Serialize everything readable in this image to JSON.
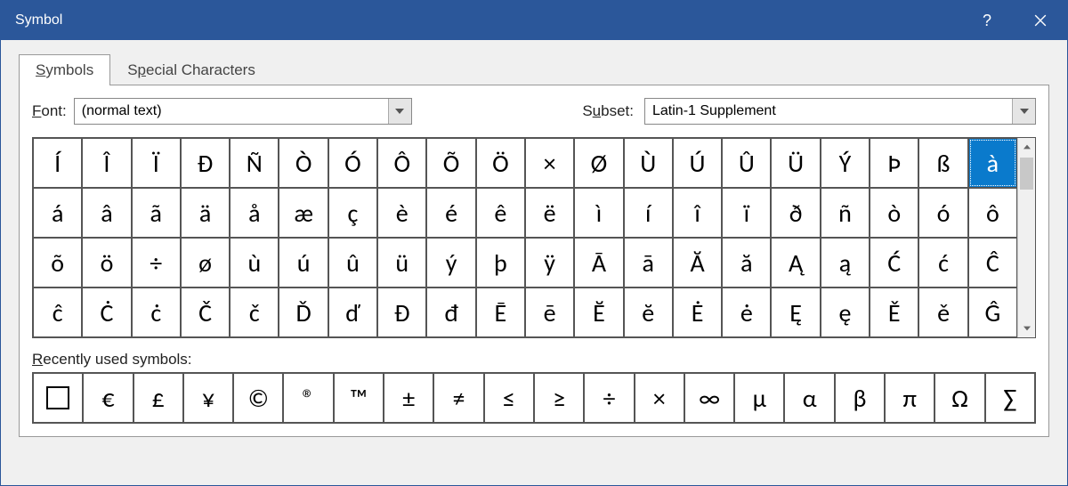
{
  "title": "Symbol",
  "tabs": {
    "symbols_prefix": "S",
    "symbols_rest": "ymbols",
    "special_prefix": "S",
    "special_mid": "p",
    "special_rest": "ecial Characters"
  },
  "font": {
    "label_prefix": "F",
    "label_rest": "ont:",
    "value": "(normal text)"
  },
  "subset": {
    "label_prefix": "S",
    "label_mid": "u",
    "label_rest": "bset:",
    "value": "Latin-1 Supplement"
  },
  "selected_index": 19,
  "grid": [
    "Í",
    "Î",
    "Ï",
    "Đ",
    "Ñ",
    "Ò",
    "Ó",
    "Ô",
    "Õ",
    "Ö",
    "×",
    "Ø",
    "Ù",
    "Ú",
    "Û",
    "Ü",
    "Ý",
    "Þ",
    "ß",
    "à",
    "á",
    "â",
    "ã",
    "ä",
    "å",
    "æ",
    "ç",
    "è",
    "é",
    "ê",
    "ë",
    "ì",
    "í",
    "î",
    "ï",
    "ð",
    "ñ",
    "ò",
    "ó",
    "ô",
    "õ",
    "ö",
    "÷",
    "ø",
    "ù",
    "ú",
    "û",
    "ü",
    "ý",
    "þ",
    "ÿ",
    "Ā",
    "ā",
    "Ă",
    "ă",
    "Ą",
    "ą",
    "Ć",
    "ć",
    "Ĉ",
    "ĉ",
    "Ċ",
    "ċ",
    "Č",
    "č",
    "Ď",
    "ď",
    "Đ",
    "đ",
    "Ē",
    "ē",
    "Ĕ",
    "ĕ",
    "Ė",
    "ė",
    "Ę",
    "ę",
    "Ě",
    "ě",
    "Ĝ"
  ],
  "recent_label_prefix": "R",
  "recent_label_rest": "ecently used symbols:",
  "recent": [
    "□",
    "€",
    "£",
    "¥",
    "©",
    "®",
    "™",
    "±",
    "≠",
    "≤",
    "≥",
    "÷",
    "×",
    "∞",
    "µ",
    "α",
    "β",
    "π",
    "Ω",
    "∑"
  ]
}
